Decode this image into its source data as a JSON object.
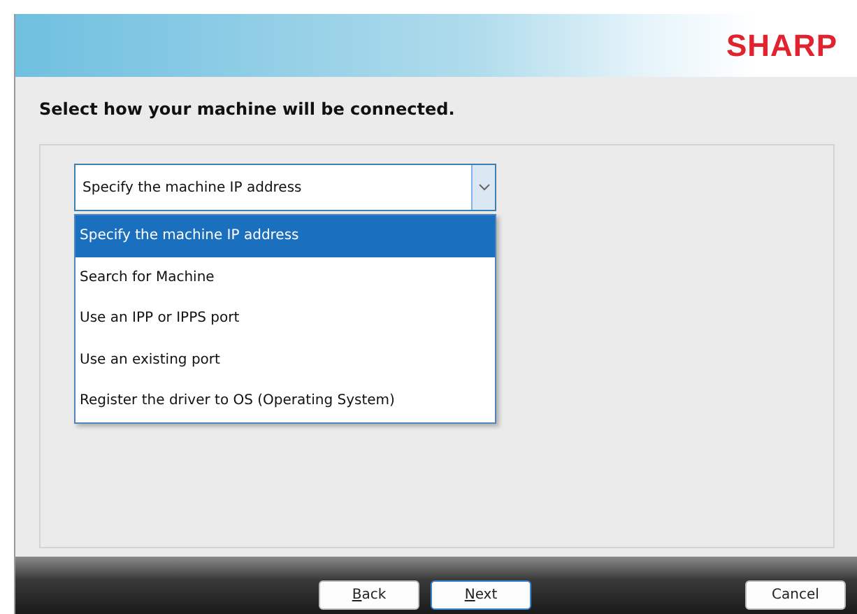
{
  "banner": {
    "logo": "SHARP"
  },
  "heading": "Select how your machine will be connected.",
  "combobox": {
    "value": "Specify the machine IP address",
    "expanded": true
  },
  "dropdown_options": [
    {
      "label": "Specify the machine IP address",
      "selected": true
    },
    {
      "label": "Search for Machine",
      "selected": false
    },
    {
      "label": "Use an IPP or IPPS port",
      "selected": false
    },
    {
      "label": "Use an existing port",
      "selected": false
    },
    {
      "label": "Register the driver to OS (Operating System)",
      "selected": false
    }
  ],
  "buttons": [
    {
      "label": "Back",
      "mnemonic_underlined": true,
      "focused": false
    },
    {
      "label": "Next",
      "mnemonic_underlined": true,
      "focused": true
    },
    {
      "label": "Cancel",
      "mnemonic_underlined": false,
      "focused": false
    }
  ]
}
